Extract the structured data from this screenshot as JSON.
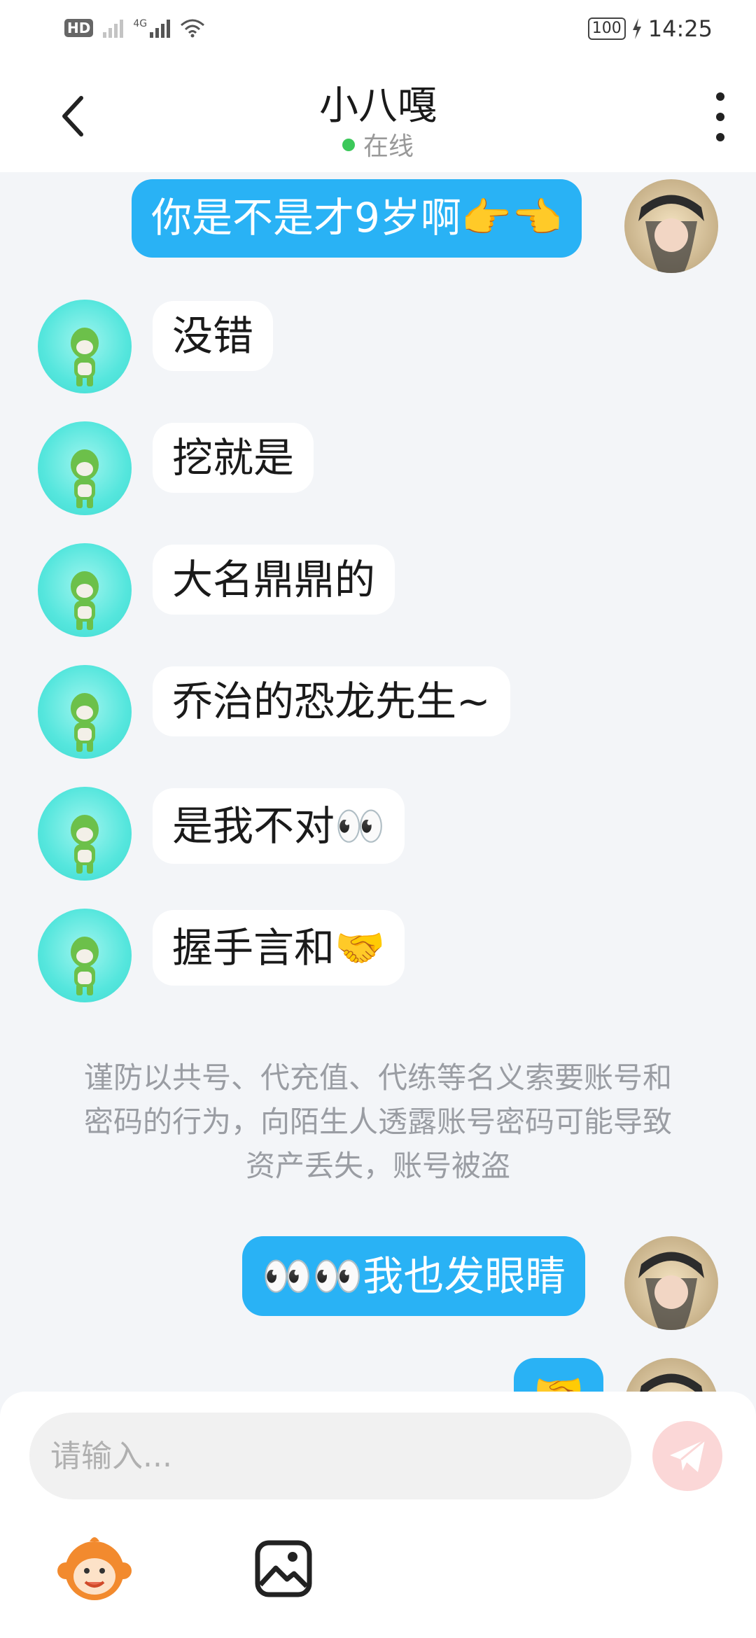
{
  "status_bar": {
    "hd_label": "HD",
    "sim_tag": "4G",
    "battery": "100",
    "time": "14:25"
  },
  "header": {
    "title": "小八嘎",
    "status": "在线"
  },
  "messages": [
    {
      "text": "你是不是才9岁啊👉👈",
      "direction": "outgoing"
    },
    {
      "text": "没错",
      "direction": "incoming"
    },
    {
      "text": "挖就是",
      "direction": "incoming"
    },
    {
      "text": "大名鼎鼎的",
      "direction": "incoming"
    },
    {
      "text": "乔治的恐龙先生~",
      "direction": "incoming"
    },
    {
      "text": "是我不对👀",
      "direction": "incoming"
    },
    {
      "text": "握手言和🤝",
      "direction": "incoming"
    },
    {
      "text": "👀👀我也发眼睛",
      "direction": "outgoing"
    },
    {
      "text": "🤝",
      "direction": "outgoing"
    }
  ],
  "notice": "谨防以共号、代充值、代练等名义索要账号和密码的行为，向陌生人透露账号密码可能导致资产丢失，账号被盗",
  "input": {
    "placeholder": "请输入..."
  },
  "colors": {
    "outgoing_bubble": "#29b2f5",
    "incoming_bubble": "#ffffff",
    "online_dot": "#3cc85a",
    "send_button": "#fbd7d7"
  },
  "icons": {
    "back": "chevron-left-icon",
    "more": "more-vertical-icon",
    "send": "paper-plane-icon",
    "emoji": "monkey-emoji-icon",
    "image": "image-icon"
  }
}
